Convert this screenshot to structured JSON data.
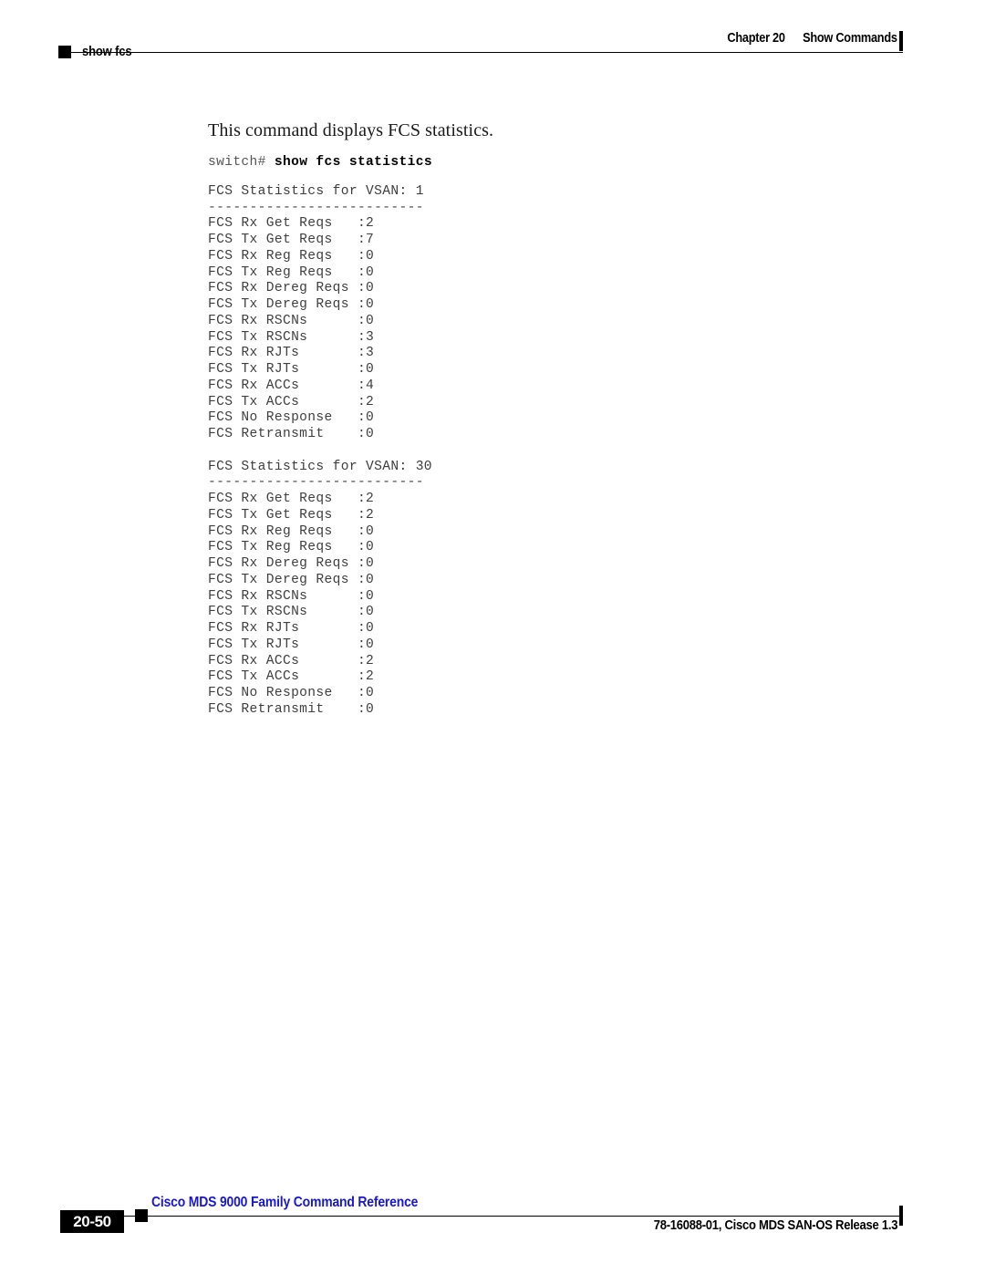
{
  "header": {
    "chapter_label": "Chapter 20",
    "section_label": "Show Commands",
    "topic": "show fcs"
  },
  "main": {
    "description": "This command displays FCS statistics.",
    "prompt": "switch# ",
    "command": "show fcs statistics",
    "separator": "--------------------------",
    "blocks": [
      {
        "title": "FCS Statistics for VSAN: 1",
        "rows": [
          {
            "label": "FCS Rx Get Reqs",
            "value": ":2"
          },
          {
            "label": "FCS Tx Get Reqs",
            "value": ":7"
          },
          {
            "label": "FCS Rx Reg Reqs",
            "value": ":0"
          },
          {
            "label": "FCS Tx Reg Reqs",
            "value": ":0"
          },
          {
            "label": "FCS Rx Dereg Reqs",
            "value": ":0"
          },
          {
            "label": "FCS Tx Dereg Reqs",
            "value": ":0"
          },
          {
            "label": "FCS Rx RSCNs",
            "value": ":0"
          },
          {
            "label": "FCS Tx RSCNs",
            "value": ":3"
          },
          {
            "label": "FCS Rx RJTs",
            "value": ":3"
          },
          {
            "label": "FCS Tx RJTs",
            "value": ":0"
          },
          {
            "label": "FCS Rx ACCs",
            "value": ":4"
          },
          {
            "label": "FCS Tx ACCs",
            "value": ":2"
          },
          {
            "label": "FCS No Response",
            "value": ":0"
          },
          {
            "label": "FCS Retransmit",
            "value": ":0"
          }
        ]
      },
      {
        "title": "FCS Statistics for VSAN: 30",
        "rows": [
          {
            "label": "FCS Rx Get Reqs",
            "value": ":2"
          },
          {
            "label": "FCS Tx Get Reqs",
            "value": ":2"
          },
          {
            "label": "FCS Rx Reg Reqs",
            "value": ":0"
          },
          {
            "label": "FCS Tx Reg Reqs",
            "value": ":0"
          },
          {
            "label": "FCS Rx Dereg Reqs",
            "value": ":0"
          },
          {
            "label": "FCS Tx Dereg Reqs",
            "value": ":0"
          },
          {
            "label": "FCS Rx RSCNs",
            "value": ":0"
          },
          {
            "label": "FCS Tx RSCNs",
            "value": ":0"
          },
          {
            "label": "FCS Rx RJTs",
            "value": ":0"
          },
          {
            "label": "FCS Tx RJTs",
            "value": ":0"
          },
          {
            "label": "FCS Rx ACCs",
            "value": ":2"
          },
          {
            "label": "FCS Tx ACCs",
            "value": ":2"
          },
          {
            "label": "FCS No Response",
            "value": ":0"
          },
          {
            "label": "FCS Retransmit",
            "value": ":0"
          }
        ]
      }
    ]
  },
  "footer": {
    "doc_title": "Cisco MDS 9000 Family Command Reference",
    "page_number": "20-50",
    "release_line": "78-16088-01, Cisco MDS SAN-OS Release 1.3"
  }
}
